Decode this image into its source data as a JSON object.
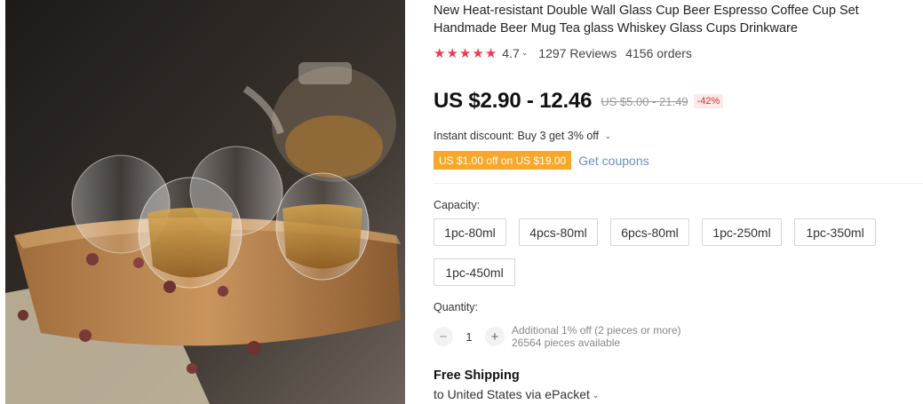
{
  "product": {
    "title": "New Heat-resistant Double Wall Glass Cup Beer Espresso Coffee Cup Set Handmade Beer Mug Tea glass Whiskey Glass Cups Drinkware",
    "image_alt": "double-wall-glass-cups-photo"
  },
  "rating": {
    "value": 4.7,
    "value_text": "4.7",
    "stars": 5,
    "reviews": "1297 Reviews",
    "orders": "4156 orders",
    "star_color": "#f0394f"
  },
  "price": {
    "current": "US $2.90 - 12.46",
    "original": "US $5.00 - 21.49",
    "discount": "-42%"
  },
  "promo": {
    "instant_discount": "Instant discount: Buy 3 get 3% off",
    "coupon": "US $1.00 off on US $19.00",
    "get_coupons": "Get coupons",
    "coupon_color": "#f7a82a"
  },
  "capacity": {
    "label": "Capacity:",
    "options": [
      "1pc-80ml",
      "4pcs-80ml",
      "6pcs-80ml",
      "1pc-250ml",
      "1pc-350ml",
      "1pc-450ml"
    ]
  },
  "quantity": {
    "label": "Quantity:",
    "value": "1",
    "minus": "−",
    "plus": "+",
    "additional": "Additional 1% off (2 pieces or more)",
    "available": "26564 pieces available"
  },
  "shipping": {
    "title": "Free Shipping",
    "destination": "to United States via ePacket"
  },
  "icons": {
    "star": "star-icon",
    "chevron": "chevron-down-icon",
    "minus": "minus-icon",
    "plus": "plus-icon"
  }
}
